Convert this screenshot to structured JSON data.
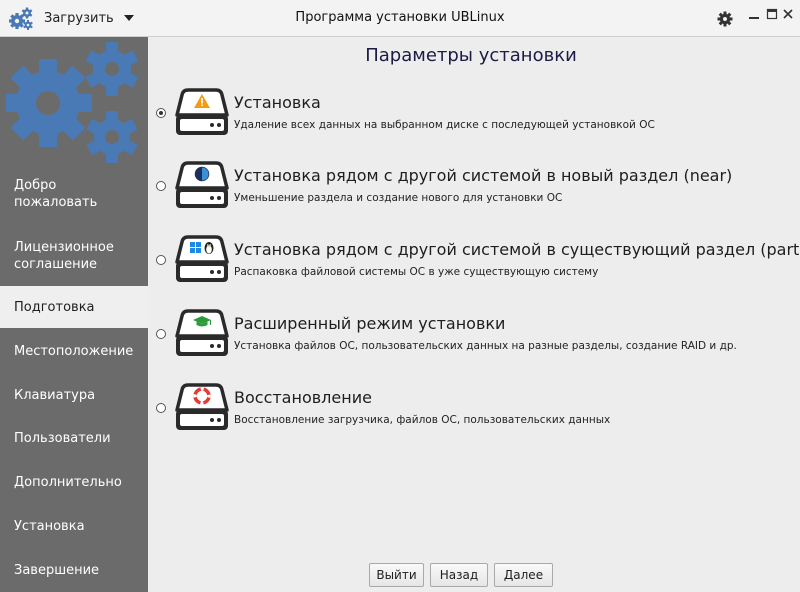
{
  "window": {
    "title": "Программа установки UBLinux",
    "menu_label": "Загрузить"
  },
  "sidebar": {
    "items": [
      {
        "label": "Добро\nпожаловать",
        "active": false
      },
      {
        "label": "Лицензионное\nсоглашение",
        "active": false
      },
      {
        "label": "Подготовка",
        "active": true
      },
      {
        "label": "Местоположение",
        "active": false
      },
      {
        "label": "Клавиатура",
        "active": false
      },
      {
        "label": "Пользователи",
        "active": false
      },
      {
        "label": "Дополнительно",
        "active": false
      },
      {
        "label": "Установка",
        "active": false
      },
      {
        "label": "Завершение",
        "active": false
      }
    ]
  },
  "main": {
    "title": "Параметры установки",
    "options": [
      {
        "title": "Установка",
        "description": "Удаление всех данных на выбранном диске с последующей установкой ОС",
        "selected": true,
        "icon": "warning-icon"
      },
      {
        "title": "Установка рядом с другой системой в новый раздел (near)",
        "description": "Уменьшение раздела и создание нового для установки ОС",
        "selected": false,
        "icon": "half-circle-icon"
      },
      {
        "title": "Установка рядом с другой системой в существующий раздел (part)",
        "description": "Распаковка файловой системы ОС в уже существующую систему",
        "selected": false,
        "icon": "windows-linux-icon"
      },
      {
        "title": "Расширенный режим установки",
        "description": "Установка файлов ОС, пользовательских данных на разные разделы, создание RAID и др.",
        "selected": false,
        "icon": "graduation-cap-icon"
      },
      {
        "title": "Восстановление",
        "description": "Восстановление загрузчика, файлов ОС, пользовательских данных",
        "selected": false,
        "icon": "lifebuoy-icon"
      }
    ]
  },
  "buttons": {
    "exit": "Выйти",
    "back": "Назад",
    "next": "Далее"
  },
  "colors": {
    "sidebar_bg": "#6b6b6b",
    "gear_blue": "#4a7ab5",
    "title_color": "#1b1b45"
  }
}
